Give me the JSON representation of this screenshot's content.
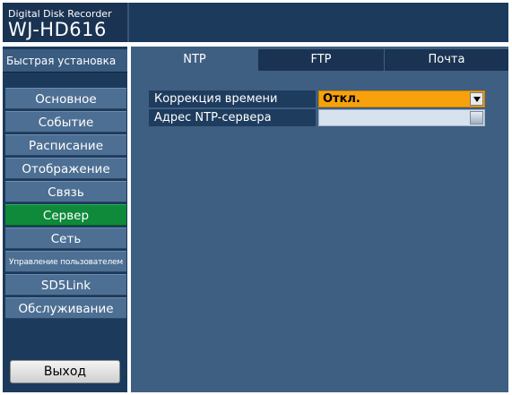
{
  "header": {
    "subtitle": "Digital Disk Recorder",
    "model": "WJ-HD616"
  },
  "sidebar": {
    "quick_setup": "Быстрая установка",
    "items": [
      {
        "label": "Основное",
        "active": false
      },
      {
        "label": "Событие",
        "active": false
      },
      {
        "label": "Расписание",
        "active": false
      },
      {
        "label": "Отображение",
        "active": false
      },
      {
        "label": "Связь",
        "active": false
      },
      {
        "label": "Сервер",
        "active": true
      },
      {
        "label": "Сеть",
        "active": false
      },
      {
        "label": "Управление пользователем",
        "active": false
      },
      {
        "label": "SD5Link",
        "active": false
      },
      {
        "label": "Обслуживание",
        "active": false
      }
    ],
    "exit_label": "Выход"
  },
  "tabs": [
    {
      "label": "NTP",
      "active": true
    },
    {
      "label": "FTP",
      "active": false
    },
    {
      "label": "Почта",
      "active": false
    }
  ],
  "ntp": {
    "time_correction_label": "Коррекция времени",
    "time_correction_value": "Откл.",
    "server_address_label": "Адрес NTP-сервера",
    "server_address_value": ""
  },
  "colors": {
    "active_nav": "#0e8a3a",
    "select_highlight": "#f7a20c",
    "panel_bg": "#3e5f82"
  }
}
